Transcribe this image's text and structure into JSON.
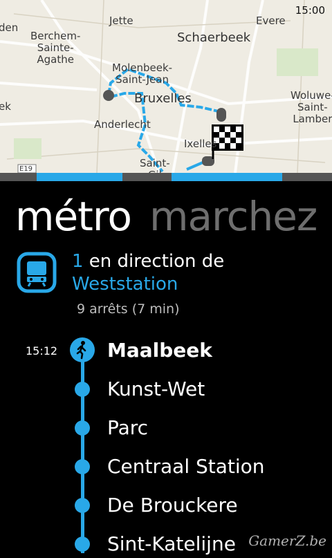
{
  "status": {
    "time": "15:00"
  },
  "map": {
    "labels": {
      "jette": "Jette",
      "evere": "Evere",
      "schaerbeek": "Schaerbeek",
      "berchem": "Berchem-\nSainte-\nAgathe",
      "molenbeek": "Molenbeek-\nSaint-Jean",
      "bruxelles": "Bruxelles",
      "anderlecht": "Anderlecht",
      "ixelles": "Ixelles",
      "woluwe": "Woluwe-\nSaint-\nLamber",
      "saint_gilles": "Saint-\nGil",
      "den": "den",
      "ek": "ek",
      "road": "E19"
    }
  },
  "pivot": {
    "active": "métro",
    "next": "marchez"
  },
  "leg": {
    "line": "1",
    "direction_text": " en direction de",
    "destination": "Weststation",
    "summary": "9 arrêts (7 min)"
  },
  "stops": [
    {
      "time": "15:12",
      "name": "Maalbeek",
      "current": true
    },
    {
      "time": "",
      "name": "Kunst-Wet",
      "current": false
    },
    {
      "time": "",
      "name": "Parc",
      "current": false
    },
    {
      "time": "",
      "name": "Centraal Station",
      "current": false
    },
    {
      "time": "",
      "name": "De Brouckere",
      "current": false
    },
    {
      "time": "",
      "name": "Sint-Katelijne",
      "current": false
    }
  ],
  "watermark": "GamerZ.be",
  "colors": {
    "accent": "#29a8e8",
    "background": "#000000"
  }
}
